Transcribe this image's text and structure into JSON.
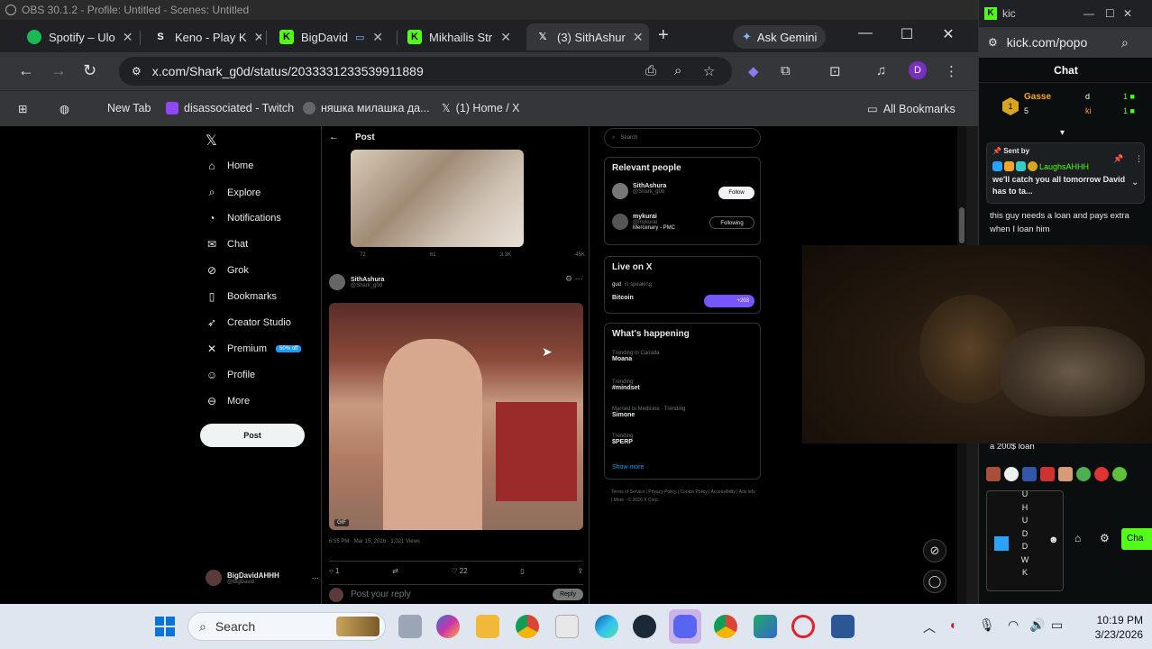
{
  "obs": {
    "title": "OBS 30.1.2 - Profile: Untitled - Scenes: Untitled"
  },
  "tabs": [
    {
      "label": "Spotify – Ulo",
      "icon": "spotify-icon"
    },
    {
      "label": "Keno - Play K",
      "icon": "stake-icon"
    },
    {
      "label": "BigDavid",
      "icon": "kick-icon"
    },
    {
      "label": "Mikhailis Str",
      "icon": "kick-icon"
    },
    {
      "label": "(3) SithAshur",
      "icon": "x-icon"
    }
  ],
  "gemini_label": "Ask Gemini",
  "url": "x.com/Shark_g0d/status/2033331233539911889",
  "profile_initial": "D",
  "bookmarks": {
    "items": [
      "New Tab",
      "disassociated - Twitch",
      "няшка милашка да...",
      "(1) Home / X"
    ],
    "all": "All Bookmarks"
  },
  "x_nav": {
    "items": [
      "Home",
      "Explore",
      "Notifications",
      "Chat",
      "Grok",
      "Bookmarks",
      "Creator Studio",
      "Premium",
      "Profile",
      "More"
    ],
    "premium_badge": "50% off",
    "post_button": "Post",
    "me_name": "BigDavidAHHH",
    "me_handle": "@BigDavid"
  },
  "post": {
    "header": "Post",
    "stats": [
      "72",
      "61",
      "3.3K",
      "45K"
    ],
    "author_name": "SithAshura",
    "author_handle": "@Shark_g0d",
    "meta": "6:55 PM · Mar 15, 2026 · 1,021 Views",
    "actions": [
      "1",
      "",
      "22",
      "",
      ""
    ],
    "reply_placeholder": "Post your reply",
    "reply_button": "Reply",
    "gif": "GIF"
  },
  "sidebar": {
    "search_placeholder": "Search",
    "relevant_title": "Relevant people",
    "people": [
      {
        "name": "SithAshura",
        "handle": "@Shark_g0d",
        "button": "Follow"
      },
      {
        "name": "mykurai",
        "handle": "@mykurai",
        "bio": "Mercenary - PMC",
        "button": "Following"
      }
    ],
    "live_title": "Live on X",
    "live_user": "gud",
    "live_status": "is speaking",
    "live_topic": "Bitcoin",
    "live_count": "+203",
    "happening_title": "What's happening",
    "trends": [
      {
        "context": "Trending in Canada",
        "name": "Moana"
      },
      {
        "context": "Trending",
        "name": "#mindset"
      },
      {
        "context": "Married to Medicine · Trending",
        "name": "Simone"
      },
      {
        "context": "Trending",
        "name": "$PERP"
      }
    ],
    "show_more": "Show more",
    "footer": "Terms of Service | Privacy Policy | Cookie Policy | Accessibility | Ads info | More · © 2026 X Corp."
  },
  "kick": {
    "window_title": "kic",
    "url": "kick.com/popo",
    "chat_header": "Chat",
    "leader1": "Gasse",
    "leader1_count": "5",
    "leader2": "d",
    "leader3": "ki",
    "pin_label": "Sent by",
    "pin_user": "LaughsAHHH",
    "pin_text": "we'll catch you all tomorrow David has to ta...",
    "msg1": "this guy needs a loan and pays extra when I loan him",
    "msg2": "a 200$ loan",
    "vertical_letters": [
      "U",
      "H",
      "U",
      "D",
      "D",
      "W",
      "K"
    ],
    "chat_button": "Cha"
  },
  "taskbar": {
    "search": "Search",
    "time": "10:19 PM",
    "date": "3/23/2026"
  }
}
